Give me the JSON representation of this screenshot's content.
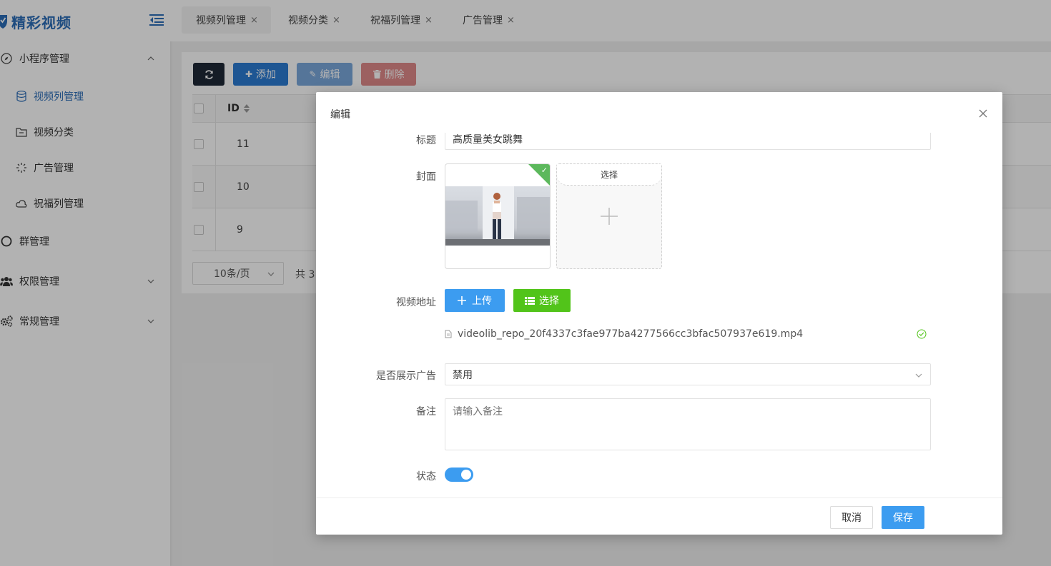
{
  "app": {
    "title": "精彩视频"
  },
  "colors": {
    "brand": "#2c6db8",
    "primary": "#3c9cf0",
    "success": "#52c41a",
    "danger": "#e08a8a"
  },
  "sidebar": {
    "groups": [
      {
        "label": "小程序管理",
        "icon": "compass-icon",
        "expanded": true
      },
      {
        "label": "群管理",
        "icon": "circle-icon",
        "expanded": false
      },
      {
        "label": "权限管理",
        "icon": "users-icon",
        "expanded": false
      },
      {
        "label": "常规管理",
        "icon": "gears-icon",
        "expanded": false
      }
    ],
    "items": [
      {
        "label": "视频列管理",
        "icon": "database-icon",
        "active": true
      },
      {
        "label": "视频分类",
        "icon": "folder-icon",
        "active": false
      },
      {
        "label": "广告管理",
        "icon": "spinner-icon",
        "active": false
      },
      {
        "label": "祝福列管理",
        "icon": "cloud-icon",
        "active": false
      }
    ]
  },
  "tabs": [
    {
      "label": "视频列管理",
      "close": "×",
      "active": true
    },
    {
      "label": "视频分类",
      "close": "×",
      "active": false
    },
    {
      "label": "祝福列管理",
      "close": "×",
      "active": false
    },
    {
      "label": "广告管理",
      "close": "×",
      "active": false
    }
  ],
  "toolbar": {
    "add": "添加",
    "edit": "编辑",
    "delete": "删除"
  },
  "table": {
    "id_header": "ID",
    "rows": [
      {
        "id": "11"
      },
      {
        "id": "10"
      },
      {
        "id": "9"
      }
    ],
    "page_size": "10条/页",
    "total_prefix": "共 3"
  },
  "modal": {
    "title": "编辑",
    "fields": {
      "title_label": "标题",
      "title_value": "高质量美女跳舞",
      "cover_label": "封面",
      "select_label": "选择",
      "video_label": "视频地址",
      "upload_btn": "上传",
      "choose_btn": "选择",
      "video_file": "videolib_repo_20f4337c3fae977ba4277566cc3bfac507937e619.mp4",
      "ad_label": "是否展示广告",
      "ad_value": "禁用",
      "remark_label": "备注",
      "remark_placeholder": "请输入备注",
      "status_label": "状态",
      "status_on": true
    },
    "cancel": "取消",
    "save": "保存"
  }
}
